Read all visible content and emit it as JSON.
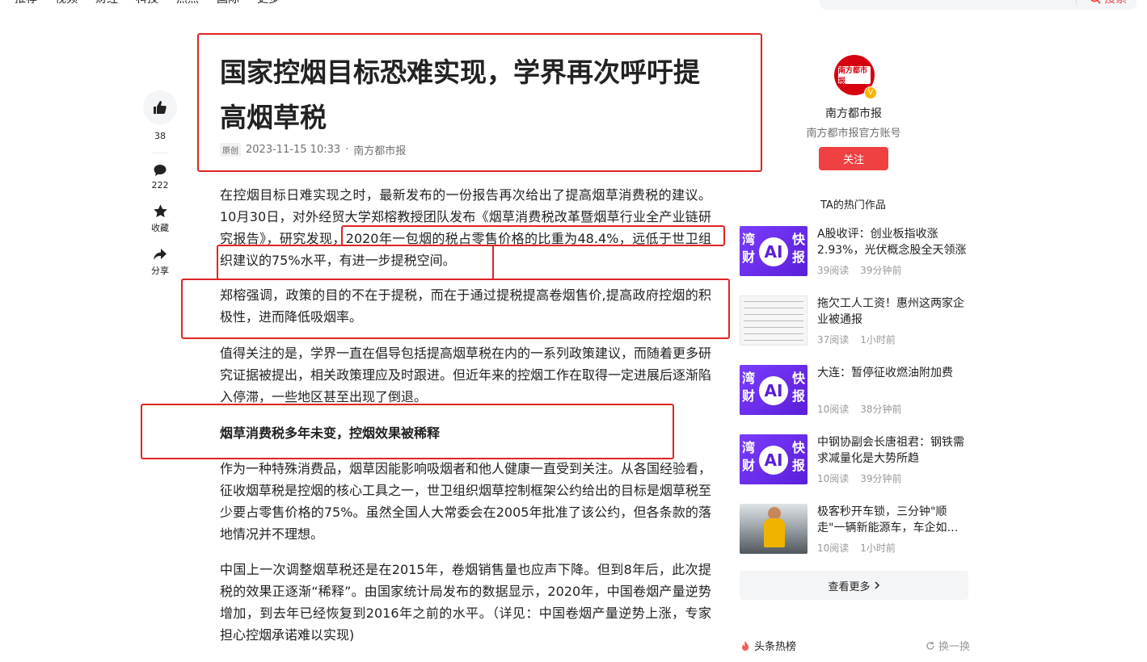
{
  "nav": {
    "items": [
      "推荐",
      "视频",
      "财经",
      "科技",
      "热点",
      "国际",
      "更多"
    ],
    "search_button": "搜索"
  },
  "rail": {
    "like_count": "38",
    "comment_count": "222",
    "favorite_label": "收藏",
    "share_label": "分享"
  },
  "article": {
    "title": "国家控烟目标恐难实现，学界再次呼吁提高烟草税",
    "original_tag": "原创",
    "datetime": "2023-11-15 10:33",
    "source": "南方都市报",
    "p1_a": "在控烟目标日难实现之时，最新发布的一份报告再次给出了提高烟草消费税的建议。10月30日，对外经贸大学郑榕教授团队发布《烟草消费税改革暨烟草行业全产业链研究报告》，研究发现，",
    "p1_b": "2020年一包烟的税占零售价格的比重为48.4%，远低于世卫组织建议的75%水平，有进一步提税空间。",
    "p2": "郑榕强调，政策的目的不在于提税，而在于通过提税提高卷烟售价,提高政府控烟的积极性，进而降低吸烟率。",
    "p3": "值得关注的是，学界一直在倡导包括提高烟草税在内的一系列政策建议，而随着更多研究证据被提出，相关政策理应及时跟进。但近年来的控烟工作在取得一定进展后逐渐陷入停滞，一些地区甚至出现了倒退。",
    "subheading": "烟草消费税多年未变，控烟效果被稀释",
    "p4": "作为一种特殊消费品，烟草因能影响吸烟者和他人健康一直受到关注。从各国经验看，征收烟草税是控烟的核心工具之一，世卫组织烟草控制框架公约给出的目标是烟草税至少要占零售价格的75%。虽然全国人大常委会在2005年批准了该公约，但各条款的落地情况并不理想。",
    "p5": "中国上一次调整烟草税还是在2015年，卷烟销售量也应声下降。但到8年后，此次提税的效果正逐渐“稀释”。由国家统计局发布的数据显示，2020年，中国卷烟产量逆势增加，到去年已经恢复到2016年之前的水平。（详见：中国卷烟产量逆势上涨，专家担心控烟承诺难以实现)"
  },
  "author": {
    "logo_text": "南方都市报",
    "verified_badge": "V",
    "name": "南方都市报",
    "description": "南方都市报官方账号",
    "follow_label": "关注"
  },
  "hot_works": {
    "title": "TA的热门作品",
    "items": [
      {
        "title": "A股收评：创业板指收涨2.93%，光伏概念股全天领涨",
        "reads": "39阅读",
        "time": "39分钟前",
        "thumb": "湾财AI快报"
      },
      {
        "title": "拖欠工人工资！惠州这两家企业被通报",
        "reads": "37阅读",
        "time": "1小时前",
        "thumb": "document"
      },
      {
        "title": "大连：暂停征收燃油附加费",
        "reads": "10阅读",
        "time": "38分钟前",
        "thumb": "湾财AI快报"
      },
      {
        "title": "中钢协副会长唐祖君：钢铁需求减量化是大势所趋",
        "reads": "10阅读",
        "time": "39分钟前",
        "thumb": "湾财AI快报"
      },
      {
        "title": "极客秒开车锁，三分钟\"顺走\"一辆新能源车，车企如…",
        "reads": "10阅读",
        "time": "1小时前",
        "thumb": "photo"
      }
    ],
    "thumb_text": {
      "l1": "湾",
      "l2": "财",
      "ai": "AI",
      "r1": "快",
      "r2": "报"
    },
    "see_more": "查看更多"
  },
  "hot_list": {
    "title": "头条热榜",
    "refresh": "换一换"
  },
  "colors": {
    "accent": "#f04142",
    "annotation": "#e02424",
    "purple": "#6a2cf0"
  }
}
